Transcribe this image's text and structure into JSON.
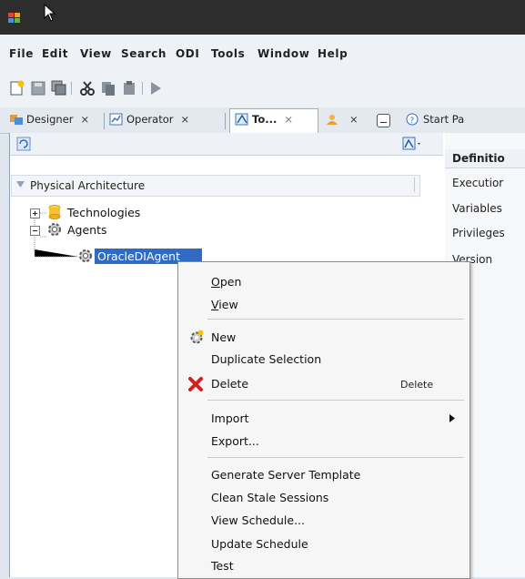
{
  "menubar": {
    "items": [
      "File",
      "Edit",
      "View",
      "Search",
      "ODI",
      "Tools",
      "Window",
      "Help"
    ]
  },
  "tabs": [
    {
      "label": "Designer",
      "close": "×",
      "icon": "designer-icon"
    },
    {
      "label": "Operator",
      "close": "×",
      "icon": "operator-icon"
    },
    {
      "label": "To...",
      "close": "×",
      "icon": "topology-icon"
    },
    {
      "label": "",
      "close": "×",
      "icon": "security-icon"
    }
  ],
  "start_page_tab": "Start Pa",
  "navigator": {
    "section": "Physical Architecture",
    "tree": {
      "technologies": "Technologies",
      "agents": "Agents",
      "agent_item": "OracleDIAgent"
    }
  },
  "right_panel": {
    "items": [
      "Definitio",
      "Executior",
      "Variables",
      "Privileges",
      "Version"
    ]
  },
  "context_menu": {
    "open": "Open",
    "view": "View",
    "new": "New",
    "duplicate": "Duplicate Selection",
    "delete": "Delete",
    "delete_accel": "Delete",
    "import": "Import",
    "export": "Export...",
    "generate": "Generate Server Template",
    "clean": "Clean Stale Sessions",
    "view_schedule": "View Schedule...",
    "update_schedule": "Update Schedule",
    "test": "Test"
  },
  "colors": {
    "selection": "#2f6bc2",
    "delete_red": "#d21f1f",
    "accent": "#1b62c0"
  }
}
